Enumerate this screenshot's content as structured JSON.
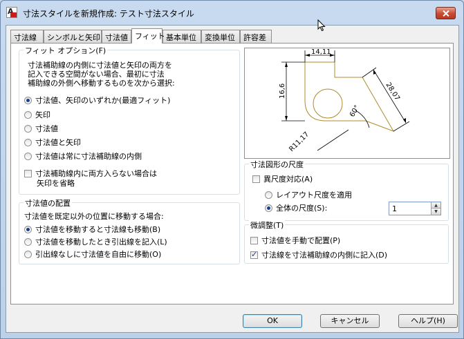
{
  "window": {
    "title": "寸法スタイルを新規作成: テスト寸法スタイル"
  },
  "tabs": [
    "寸法線",
    "シンボルと矢印",
    "寸法値",
    "フィット",
    "基本単位",
    "変換単位",
    "許容差"
  ],
  "fit_options": {
    "title": "フィット オプション(F)",
    "description": [
      "寸法補助線の内側に寸法値と矢印の両方を",
      "記入できる空間がない場合、最初に寸法",
      "補助線の外側へ移動するものを次から選択:"
    ],
    "radios": [
      {
        "label": "寸法値、矢印のいずれか(最適フィット)",
        "checked": true
      },
      {
        "label": "矢印",
        "checked": false
      },
      {
        "label": "寸法値",
        "checked": false
      },
      {
        "label": "寸法値と矢印",
        "checked": false
      },
      {
        "label": "寸法値は常に寸法補助線の内側",
        "checked": false
      }
    ],
    "suppress_arrows": {
      "label_line1": "寸法補助線内に両方入らない場合は",
      "label_line2": "矢印を省略",
      "checked": false
    }
  },
  "text_placement": {
    "title": "寸法値の配置",
    "description": "寸法値を既定以外の位置に移動する場合:",
    "radios": [
      {
        "label": "寸法値を移動すると寸法線も移動(B)",
        "checked": true
      },
      {
        "label": "寸法値を移動したとき引出線を記入(L)",
        "checked": false
      },
      {
        "label": "引出線なしに寸法値を自由に移動(O)",
        "checked": false
      }
    ]
  },
  "preview": {
    "dim_top": "14,11",
    "dim_left": "16,6",
    "dim_diag": "28,07",
    "angle": "60°",
    "radius": "R11,17",
    "line_color": "#b08a2a"
  },
  "scale": {
    "title": "寸法図形の尺度",
    "annotative": {
      "label": "異尺度対応(A)",
      "checked": false
    },
    "layout_scale": {
      "label": "レイアウト尺度を適用",
      "checked": false
    },
    "overall_scale": {
      "label": "全体の尺度(S):",
      "checked": true,
      "value": "1"
    }
  },
  "fine_tuning": {
    "title": "微調整(T)",
    "manual_text": {
      "label": "寸法値を手動で配置(P)",
      "checked": false
    },
    "draw_dim_line": {
      "label": "寸法線を寸法補助線の内側に記入(D)",
      "checked": true
    }
  },
  "buttons": {
    "ok": "OK",
    "cancel": "キャンセル",
    "help": "ヘルプ(H)"
  }
}
